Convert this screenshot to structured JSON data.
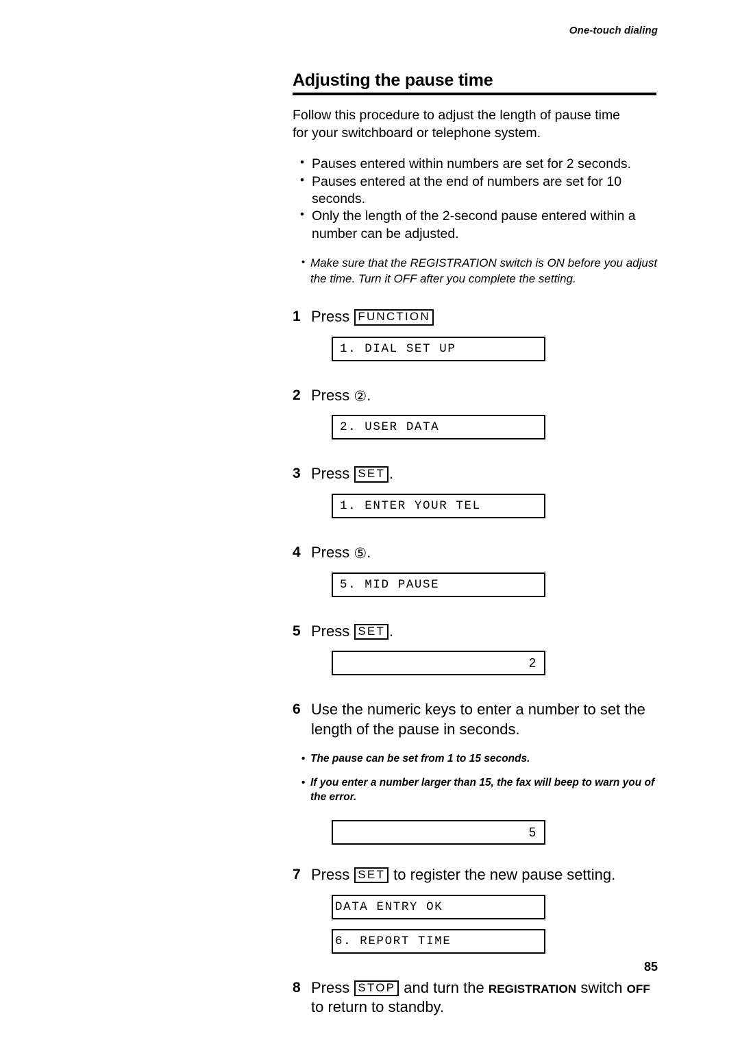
{
  "header": {
    "running_head": "One-touch dialing"
  },
  "section": {
    "title": "Adjusting the pause time",
    "intro": "Follow this procedure to adjust the length of pause time for your switchboard or telephone system."
  },
  "bullets": [
    "Pauses entered within numbers are set for 2 seconds.",
    "Pauses entered at the end of numbers are set for 10 seconds.",
    "Only the length of the 2-second pause entered within a number can be adjusted."
  ],
  "notes": [
    "Make sure that the REGISTRATION switch is ON before you adjust the time.  Turn it OFF after you complete the setting."
  ],
  "steps": {
    "s1": {
      "number": "1",
      "press_label": "Press",
      "key": "FUNCTION",
      "lcd": "1. DIAL SET UP"
    },
    "s2": {
      "number": "2",
      "press_label": "Press",
      "key": "②",
      "period": ".",
      "lcd": "2. USER DATA"
    },
    "s3": {
      "number": "3",
      "press_label": "Press",
      "key": "SET",
      "period": ".",
      "lcd": "1. ENTER YOUR TEL"
    },
    "s4": {
      "number": "4",
      "press_label": "Press",
      "key": "⑤",
      "period": ".",
      "lcd": "5. MID PAUSE"
    },
    "s5": {
      "number": "5",
      "press_label": "Press",
      "key": "SET",
      "period": ".",
      "lcd": "2"
    },
    "s6": {
      "number": "6",
      "text": "Use the numeric keys to enter a number to set the length of the pause in seconds.",
      "notes": [
        "The pause can be set from 1 to 15 seconds.",
        "If you enter a number larger than 15, the fax will beep to warn you of the error."
      ],
      "lcd": "5"
    },
    "s7": {
      "number": "7",
      "press_label": "Press",
      "key": "SET",
      "tail": " to register the new pause setting.",
      "lcd_1": "DATA ENTRY OK",
      "lcd_2": "6. REPORT TIME"
    },
    "s8": {
      "number": "8",
      "press_label": "Press",
      "key": "STOP",
      "mid": " and turn the ",
      "emph_1": "REGISTRATION",
      "tail_1": " switch ",
      "emph_2": "OFF",
      "tail_2": " to return to standby."
    }
  },
  "footer": {
    "page_number": "85"
  }
}
